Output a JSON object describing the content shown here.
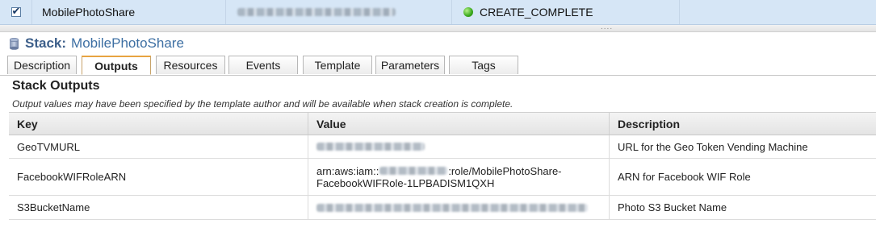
{
  "stack_list": {
    "selected_row": {
      "name": "MobilePhotoShare",
      "status": "CREATE_COMPLETE",
      "checked": true
    }
  },
  "stack_header": {
    "label": "Stack:",
    "name": "MobilePhotoShare"
  },
  "tabs": [
    {
      "label": "Description",
      "active": false
    },
    {
      "label": "Outputs",
      "active": true
    },
    {
      "label": "Resources",
      "active": false
    },
    {
      "label": "Events",
      "active": false
    },
    {
      "label": "Template",
      "active": false
    },
    {
      "label": "Parameters",
      "active": false
    },
    {
      "label": "Tags",
      "active": false
    }
  ],
  "outputs": {
    "title": "Stack Outputs",
    "note": "Output values may have been specified by the template author and will be available when stack creation is complete.",
    "columns": [
      "Key",
      "Value",
      "Description"
    ],
    "rows": [
      {
        "key": "GeoTVMURL",
        "value_prefix": "",
        "value_suffix": "",
        "description": "URL for the Geo Token Vending Machine"
      },
      {
        "key": "FacebookWIFRoleARN",
        "value_prefix": "arn:aws:iam::",
        "value_suffix": ":role/MobilePhotoShare-",
        "value_line2": "FacebookWIFRole-1LPBADISM1QXH",
        "description": "ARN for Facebook WIF Role"
      },
      {
        "key": "S3BucketName",
        "value_prefix": "",
        "value_suffix": "",
        "description": "Photo S3 Bucket Name"
      }
    ]
  },
  "colors": {
    "selected_row_bg": "#d6e6f6",
    "status_ok": "#39a81c",
    "active_tab_accent": "#e8a441",
    "stack_title": "#3d6fa3"
  }
}
